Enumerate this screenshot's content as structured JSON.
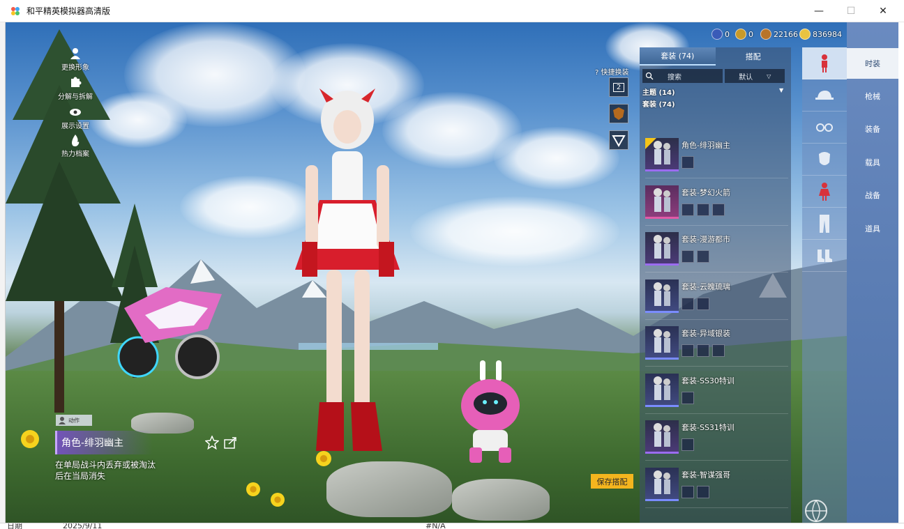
{
  "window": {
    "title": "和平精英模拟器高清版",
    "min": "—",
    "max": "☐",
    "close": "✕"
  },
  "left_menu": [
    {
      "label": "更换形象",
      "icon": "person-icon"
    },
    {
      "label": "分解与拆解",
      "icon": "puzzle-icon"
    },
    {
      "label": "展示设置",
      "icon": "eye-icon"
    },
    {
      "label": "热力档案",
      "icon": "flame-icon"
    }
  ],
  "currencies": [
    {
      "value": "0",
      "icon": "coin-blue-icon",
      "color": "#3a5bb8"
    },
    {
      "value": "0",
      "icon": "coin-gold-icon",
      "color": "#c89a2a"
    },
    {
      "value": "22166",
      "icon": "coin-bronze-icon",
      "color": "#b8742a"
    },
    {
      "value": "836984",
      "icon": "coin-yellow-icon",
      "color": "#e9c341"
    }
  ],
  "quick_change": {
    "label": "快捷换装",
    "slot_number": "2"
  },
  "panel": {
    "tabs": [
      "套装 (74)",
      "搭配"
    ],
    "search_placeholder": "搜索",
    "sort_label": "默认",
    "group_theme": "主题 (14)",
    "group_suits": "套装 (74)",
    "items": [
      {
        "name": "角色-绯羽幽主",
        "style": "purple",
        "minis": 1,
        "badge": true
      },
      {
        "name": "套装-梦幻火箭",
        "style": "pink",
        "minis": 3,
        "badge": false
      },
      {
        "name": "套装-漫游都市",
        "style": "purple",
        "minis": 2,
        "badge": false
      },
      {
        "name": "套装-云魄琉璃",
        "style": "blue",
        "minis": 2,
        "badge": false
      },
      {
        "name": "套装-异域银装",
        "style": "blue",
        "minis": 3,
        "badge": false
      },
      {
        "name": "套装-SS30特训",
        "style": "blue",
        "minis": 1,
        "badge": false
      },
      {
        "name": "套装-SS31特训",
        "style": "purple",
        "minis": 1,
        "badge": false
      },
      {
        "name": "套装-智谋强哥",
        "style": "blue",
        "minis": 2,
        "badge": false
      }
    ]
  },
  "categories": [
    "character-icon",
    "cap-icon",
    "glasses-icon",
    "mask-icon",
    "outfit-icon",
    "pants-icon",
    "shoes-icon"
  ],
  "right_nav": [
    "时装",
    "枪械",
    "装备",
    "载具",
    "战备",
    "道具"
  ],
  "selected": {
    "action_tag": "动作",
    "name": "角色-绯羽幽主",
    "description": "在单局战斗内丢弃或被淘汰后在当局消失"
  },
  "save_button": "保存搭配",
  "background_sheet": {
    "cell_a": "日期",
    "cell_b": "2025/9/11",
    "cell_c": "#N/A"
  }
}
